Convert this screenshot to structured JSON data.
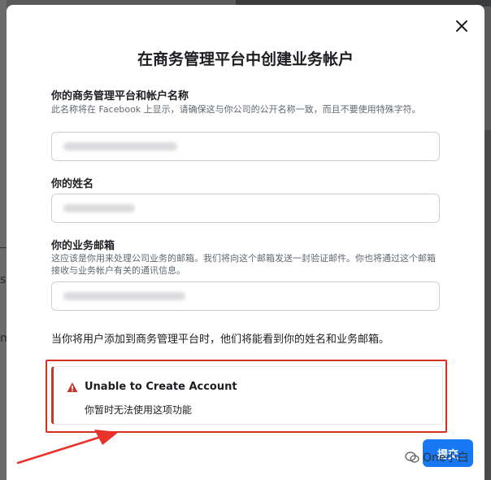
{
  "background": {
    "fragments": [
      "s",
      "m"
    ]
  },
  "modal": {
    "title": "在商务管理平台中创建业务帐户",
    "close_icon": "close-icon",
    "fields": [
      {
        "label": "你的商务管理平台和帐户名称",
        "help": "此名称将在 Facebook 上显示，请确保这与你公司的公开名称一致，而且不要使用特殊字符。",
        "value": ""
      },
      {
        "label": "你的姓名",
        "help": "",
        "value": ""
      },
      {
        "label": "你的业务邮箱",
        "help": "这应该是你用来处理公司业务的邮箱。我们将向这个邮箱发送一封验证邮件。你也将通过这个邮箱接收与业务帐户有关的通讯信息。",
        "value": ""
      }
    ],
    "note": "当你将用户添加到商务管理平台时，他们将能看到你的姓名和业务邮箱。",
    "error": {
      "icon": "warning-icon",
      "title": "Unable to Create Account",
      "message": "你暂时无法使用这项功能"
    },
    "submit_label": "提交"
  },
  "watermark": {
    "text": "One小白"
  },
  "colors": {
    "primary": "#1877f2",
    "error_outline": "#d93025",
    "error_accent": "#be3a2e"
  }
}
